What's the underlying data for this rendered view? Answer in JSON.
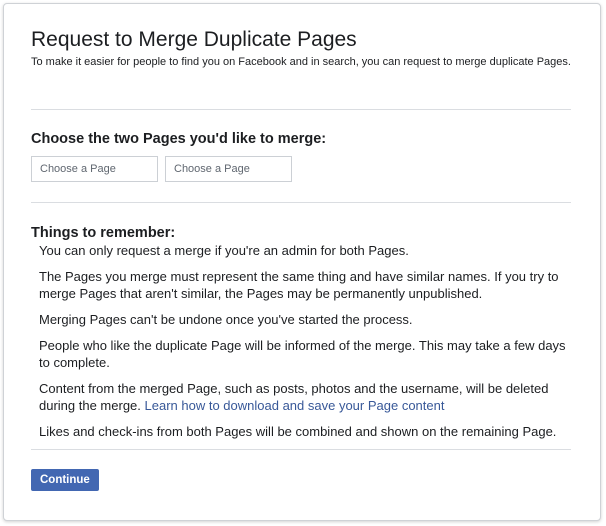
{
  "dialog": {
    "title": "Request to Merge Duplicate Pages",
    "subtitle": "To make it easier for people to find you on Facebook and in search, you can request to merge duplicate Pages."
  },
  "merge_section": {
    "heading": "Choose the two Pages you'd like to merge:",
    "picker_1_placeholder": "Choose a Page",
    "picker_2_placeholder": "Choose a Page"
  },
  "remember_section": {
    "heading": "Things to remember:",
    "items": [
      "You can only request a merge if you're an admin for both Pages.",
      "The Pages you merge must represent the same thing and have similar names. If you try to merge Pages that aren't similar, the Pages may be permanently unpublished.",
      "Merging Pages can't be undone once you've started the process.",
      "People who like the duplicate Page will be informed of the merge. This may take a few days to complete.",
      "Content from the merged Page, such as posts, photos and the username, will be deleted during the merge.",
      "Likes and check-ins from both Pages will be combined and shown on the remaining Page."
    ],
    "download_link": "Learn how to download and save your Page content"
  },
  "actions": {
    "continue_label": "Continue"
  },
  "colors": {
    "primary_button": "#4267b2",
    "link": "#385898",
    "text": "#1c1e21",
    "divider": "#dadde1"
  }
}
